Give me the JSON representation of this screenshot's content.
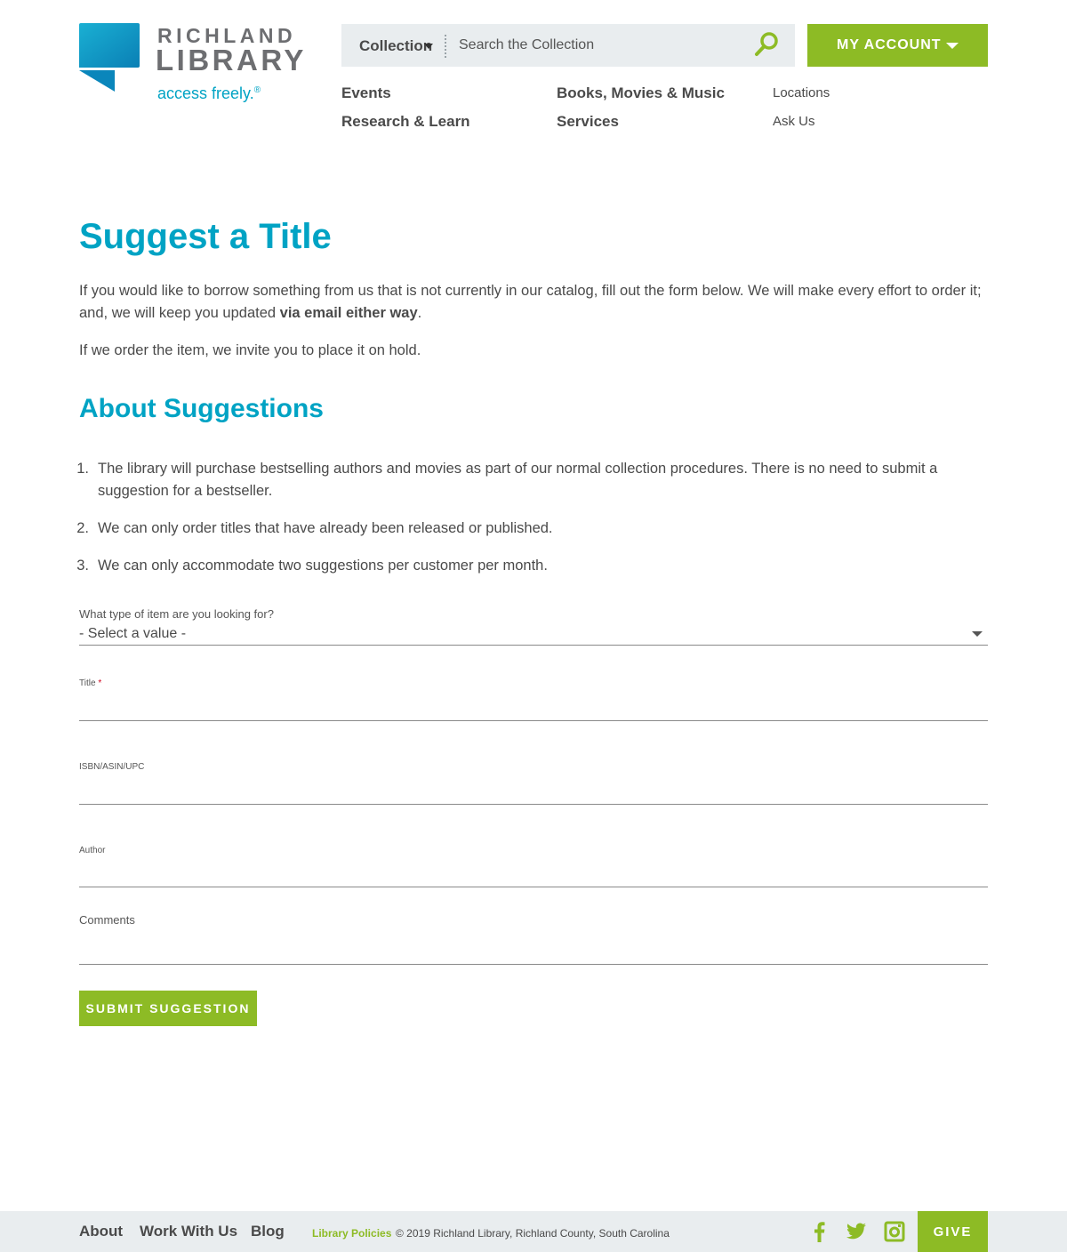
{
  "brand": {
    "line1": "RICHLAND",
    "line2": "LIBRARY",
    "tagline": "access freely.",
    "tagline_mark": "®",
    "primary_color": "#00a3c4",
    "accent_color": "#8dbb25"
  },
  "search": {
    "scope_label": "Collection",
    "placeholder": "Search the Collection",
    "button_icon": "search-icon"
  },
  "account": {
    "label": "MY ACCOUNT"
  },
  "nav": {
    "events": "Events",
    "research": "Research & Learn",
    "books": "Books, Movies & Music",
    "services": "Services",
    "locations": "Locations",
    "ask_us": "Ask Us"
  },
  "page": {
    "title": "Suggest a Title",
    "intro_part1": "If you would like to borrow something from us that is not currently in our catalog, fill out the form below. We will make every effort to order it; and, we will keep you updated ",
    "intro_bold": "via email either way",
    "intro_part2": ".",
    "intro2": "If we order the item, we invite you to place it on hold.",
    "section_title": "About Suggestions",
    "rules": [
      {
        "num": "1.",
        "text": "The library will purchase bestselling authors and movies as part of our normal collection procedures. There is no need to submit a suggestion for a bestseller."
      },
      {
        "num": "2.",
        "text": "We can only order titles that have already been released or published."
      },
      {
        "num": "3.",
        "text": "We can only accommodate two suggestions per customer per month."
      }
    ]
  },
  "form": {
    "type_label": "What type of item are you looking for?",
    "type_value": "- Select a value -",
    "title_label": "Title",
    "required_mark": "*",
    "isbn_label": "ISBN/ASIN/UPC",
    "author_label": "Author",
    "comments_label": "Comments",
    "submit_label": "SUBMIT SUGGESTION"
  },
  "footer": {
    "about": "About",
    "work": "Work With Us",
    "blog": "Blog",
    "policies": "Library Policies",
    "copyright": "© 2019 Richland Library, Richland County, South Carolina",
    "social_icons": [
      "facebook-icon",
      "twitter-icon",
      "instagram-icon"
    ],
    "give": "GIVE"
  }
}
